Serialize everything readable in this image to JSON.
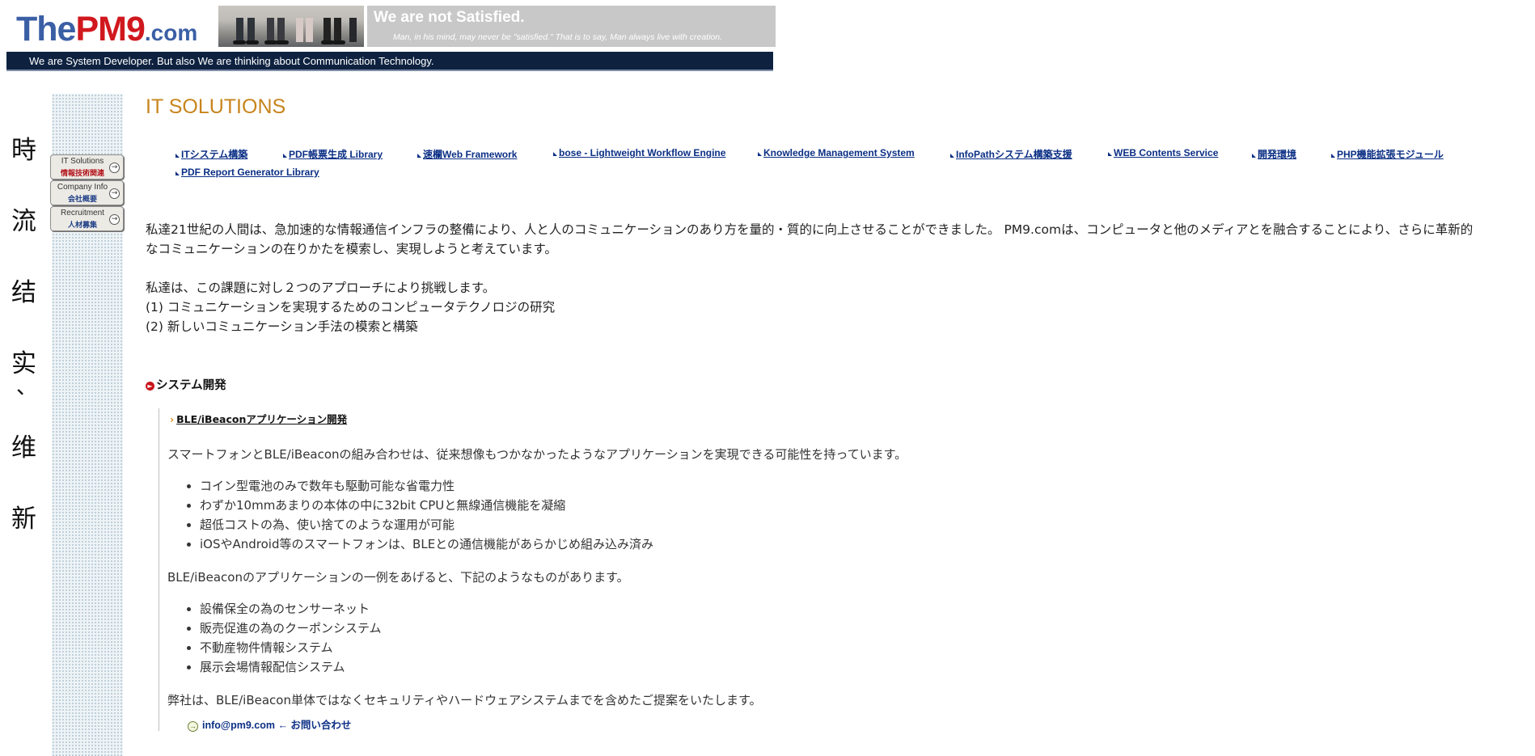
{
  "header": {
    "logo": {
      "part1": "The",
      "part2": "PM9",
      "part3": ".com"
    },
    "banner_title": "We are not Satisfied.",
    "banner_subtitle": "Man, in his mind, may never be \"satisfied.\" That is to say, Man always live with creation.",
    "tagline": "We are System Developer. But also We are thinking about Communication Technology."
  },
  "vertical_motto": [
    "時",
    "流",
    "结",
    "实",
    "、",
    "维",
    "新"
  ],
  "sidebar": {
    "buttons": [
      {
        "en": "IT Solutions",
        "jp": "情報技術関連"
      },
      {
        "en": "Company Info",
        "jp": "会社概要"
      },
      {
        "en": "Recruitment",
        "jp": "人材募集"
      }
    ]
  },
  "main": {
    "title": "IT SOLUTIONS",
    "nav_links": [
      "ITシステム構築",
      "PDF帳票生成 Library",
      "速欄Web Framework",
      "bose - Lightweight Workflow Engine",
      "Knowledge Management System",
      "InfoPathシステム構築支援",
      "WEB Contents Service",
      "開発環境",
      "PHP機能拡張モジュール",
      "PDF Report Generator Library"
    ],
    "intro_line1": "私達21世紀の人間は、急加速的な情報通信インフラの整備により、人と人のコミュニケーションのあり方を量的・質的に向上させることができました。 PM9.comは、コンピュータと他のメディアとを融合することにより、さらに革新的",
    "intro_line2": "なコミュニケーションの在りかたを模索し、実現しようと考えています。",
    "approach_intro": "私達は、この課題に対し２つのアプローチにより挑戦します。",
    "approach_1": "(1) コミュニケーションを実現するためのコンピュータテクノロジの研究",
    "approach_2": "(2) 新しいコミュニケーション手法の模索と構築",
    "section_heading": "システム開発",
    "sub_link": "BLE/iBeaconアプリケーション開発",
    "p1": "スマートフォンとBLE/iBeaconの組み合わせは、従来想像もつかなかったようなアプリケーションを実現できる可能性を持っています。",
    "features": [
      "コイン型電池のみで数年も駆動可能な省電力性",
      "わずか10mmあまりの本体の中に32bit CPUと無線通信機能を凝縮",
      "超低コストの為、使い捨てのような運用が可能",
      "iOSやAndroid等のスマートフォンは、BLEとの通信機能があらかじめ組み込み済み"
    ],
    "p2": "BLE/iBeaconのアプリケーションの一例をあげると、下記のようなものがあります。",
    "examples": [
      "設備保全の為のセンサーネット",
      "販売促進の為のクーポンシステム",
      "不動産物件情報システム",
      "展示会場情報配信システム"
    ],
    "p3": "弊社は、BLE/iBeacon単体ではなくセキュリティやハードウェアシステムまでを含めたご提案をいたします。",
    "contact": "info@pm9.com ← お問い合わせ"
  },
  "colors": {
    "logo_blue": "#3b5fa5",
    "logo_red": "#d0181e",
    "navy": "#0e2240",
    "title_orange": "#c8841c",
    "link_blue": "#0b2f85"
  }
}
